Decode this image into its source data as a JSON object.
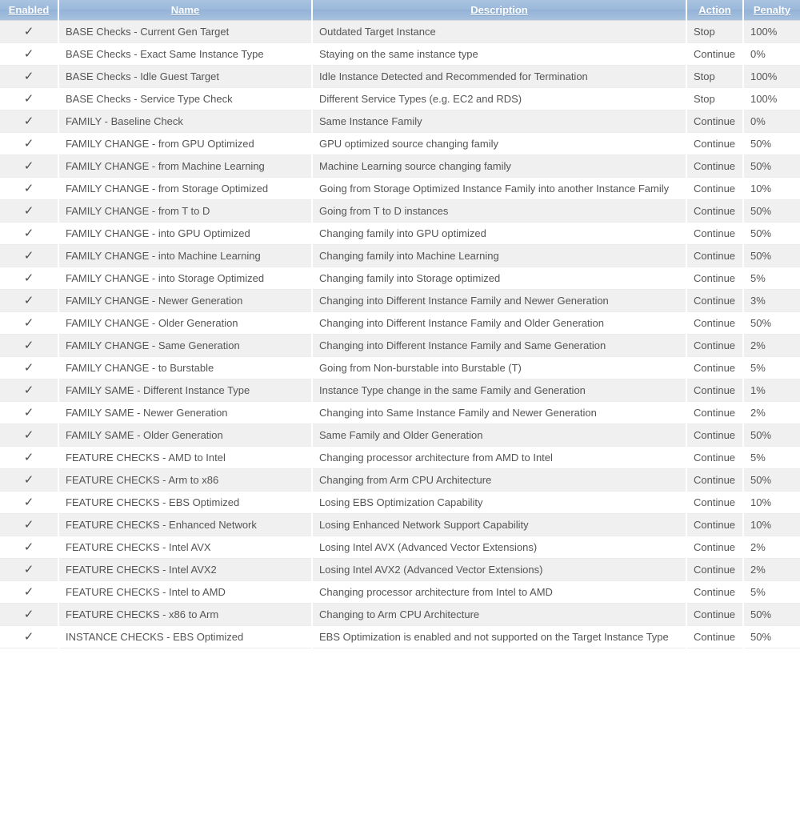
{
  "table": {
    "columns": [
      {
        "key": "enabled",
        "label": "Enabled"
      },
      {
        "key": "name",
        "label": "Name"
      },
      {
        "key": "desc",
        "label": "Description"
      },
      {
        "key": "action",
        "label": "Action"
      },
      {
        "key": "penalty",
        "label": "Penalty"
      }
    ],
    "check_glyph": "✓",
    "colors": {
      "header_start": "#a9c3e0",
      "header_end": "#93b2d6",
      "header_text": "#ffffff",
      "row_odd": "#f0f0f0",
      "row_even": "#ffffff",
      "body_text": "#555555"
    },
    "rows": [
      {
        "enabled": "✓",
        "name": "BASE Checks - Current Gen Target",
        "desc": "Outdated Target Instance",
        "action": "Stop",
        "penalty": "100%"
      },
      {
        "enabled": "✓",
        "name": "BASE Checks - Exact Same Instance Type",
        "desc": "Staying on the same instance type",
        "action": "Continue",
        "penalty": "0%"
      },
      {
        "enabled": "✓",
        "name": "BASE Checks - Idle Guest Target",
        "desc": "Idle Instance Detected and Recommended for Termination",
        "action": "Stop",
        "penalty": "100%"
      },
      {
        "enabled": "✓",
        "name": "BASE Checks - Service Type Check",
        "desc": "Different Service Types (e.g. EC2 and RDS)",
        "action": "Stop",
        "penalty": "100%"
      },
      {
        "enabled": "✓",
        "name": "FAMILY - Baseline Check",
        "desc": "Same Instance Family",
        "action": "Continue",
        "penalty": "0%"
      },
      {
        "enabled": "✓",
        "name": "FAMILY CHANGE - from GPU Optimized",
        "desc": "GPU optimized source changing family",
        "action": "Continue",
        "penalty": "50%"
      },
      {
        "enabled": "✓",
        "name": "FAMILY CHANGE - from Machine Learning",
        "desc": "Machine Learning source changing family",
        "action": "Continue",
        "penalty": "50%"
      },
      {
        "enabled": "✓",
        "name": "FAMILY CHANGE - from Storage Optimized",
        "desc": "Going from Storage Optimized Instance Family into another Instance Family",
        "action": "Continue",
        "penalty": "10%"
      },
      {
        "enabled": "✓",
        "name": "FAMILY CHANGE - from T to D",
        "desc": "Going from T to D instances",
        "action": "Continue",
        "penalty": "50%"
      },
      {
        "enabled": "✓",
        "name": "FAMILY CHANGE - into GPU Optimized",
        "desc": "Changing family into GPU optimized",
        "action": "Continue",
        "penalty": "50%"
      },
      {
        "enabled": "✓",
        "name": "FAMILY CHANGE - into Machine Learning",
        "desc": "Changing family into Machine Learning",
        "action": "Continue",
        "penalty": "50%"
      },
      {
        "enabled": "✓",
        "name": "FAMILY CHANGE - into Storage Optimized",
        "desc": "Changing family into Storage optimized",
        "action": "Continue",
        "penalty": "5%"
      },
      {
        "enabled": "✓",
        "name": "FAMILY CHANGE - Newer Generation",
        "desc": "Changing into Different Instance Family and Newer Generation",
        "action": "Continue",
        "penalty": "3%"
      },
      {
        "enabled": "✓",
        "name": "FAMILY CHANGE - Older Generation",
        "desc": "Changing into Different Instance Family and Older Generation",
        "action": "Continue",
        "penalty": "50%"
      },
      {
        "enabled": "✓",
        "name": "FAMILY CHANGE - Same Generation",
        "desc": "Changing into Different Instance Family and Same Generation",
        "action": "Continue",
        "penalty": "2%"
      },
      {
        "enabled": "✓",
        "name": "FAMILY CHANGE - to Burstable",
        "desc": "Going from Non-burstable into Burstable (T)",
        "action": "Continue",
        "penalty": "5%"
      },
      {
        "enabled": "✓",
        "name": "FAMILY SAME - Different Instance Type",
        "desc": "Instance Type change in the same Family and Generation",
        "action": "Continue",
        "penalty": "1%"
      },
      {
        "enabled": "✓",
        "name": "FAMILY SAME - Newer Generation",
        "desc": "Changing into Same Instance Family and Newer Generation",
        "action": "Continue",
        "penalty": "2%"
      },
      {
        "enabled": "✓",
        "name": "FAMILY SAME - Older Generation",
        "desc": "Same Family and Older Generation",
        "action": "Continue",
        "penalty": "50%"
      },
      {
        "enabled": "✓",
        "name": "FEATURE CHECKS - AMD to Intel",
        "desc": "Changing processor architecture from AMD to Intel",
        "action": "Continue",
        "penalty": "5%"
      },
      {
        "enabled": "✓",
        "name": "FEATURE CHECKS - Arm to x86",
        "desc": "Changing from Arm CPU Architecture",
        "action": "Continue",
        "penalty": "50%"
      },
      {
        "enabled": "✓",
        "name": "FEATURE CHECKS - EBS Optimized",
        "desc": "Losing EBS Optimization Capability",
        "action": "Continue",
        "penalty": "10%"
      },
      {
        "enabled": "✓",
        "name": "FEATURE CHECKS - Enhanced Network",
        "desc": "Losing Enhanced Network Support Capability",
        "action": "Continue",
        "penalty": "10%"
      },
      {
        "enabled": "✓",
        "name": "FEATURE CHECKS - Intel AVX",
        "desc": "Losing Intel AVX (Advanced Vector Extensions)",
        "action": "Continue",
        "penalty": "2%"
      },
      {
        "enabled": "✓",
        "name": "FEATURE CHECKS - Intel AVX2",
        "desc": "Losing Intel AVX2 (Advanced Vector Extensions)",
        "action": "Continue",
        "penalty": "2%"
      },
      {
        "enabled": "✓",
        "name": "FEATURE CHECKS - Intel to AMD",
        "desc": "Changing processor architecture from Intel to AMD",
        "action": "Continue",
        "penalty": "5%"
      },
      {
        "enabled": "✓",
        "name": "FEATURE CHECKS - x86 to Arm",
        "desc": "Changing to Arm CPU Architecture",
        "action": "Continue",
        "penalty": "50%"
      },
      {
        "enabled": "✓",
        "name": "INSTANCE CHECKS - EBS Optimized",
        "desc": "EBS Optimization is enabled and not supported on the Target Instance Type",
        "action": "Continue",
        "penalty": "50%"
      }
    ]
  }
}
